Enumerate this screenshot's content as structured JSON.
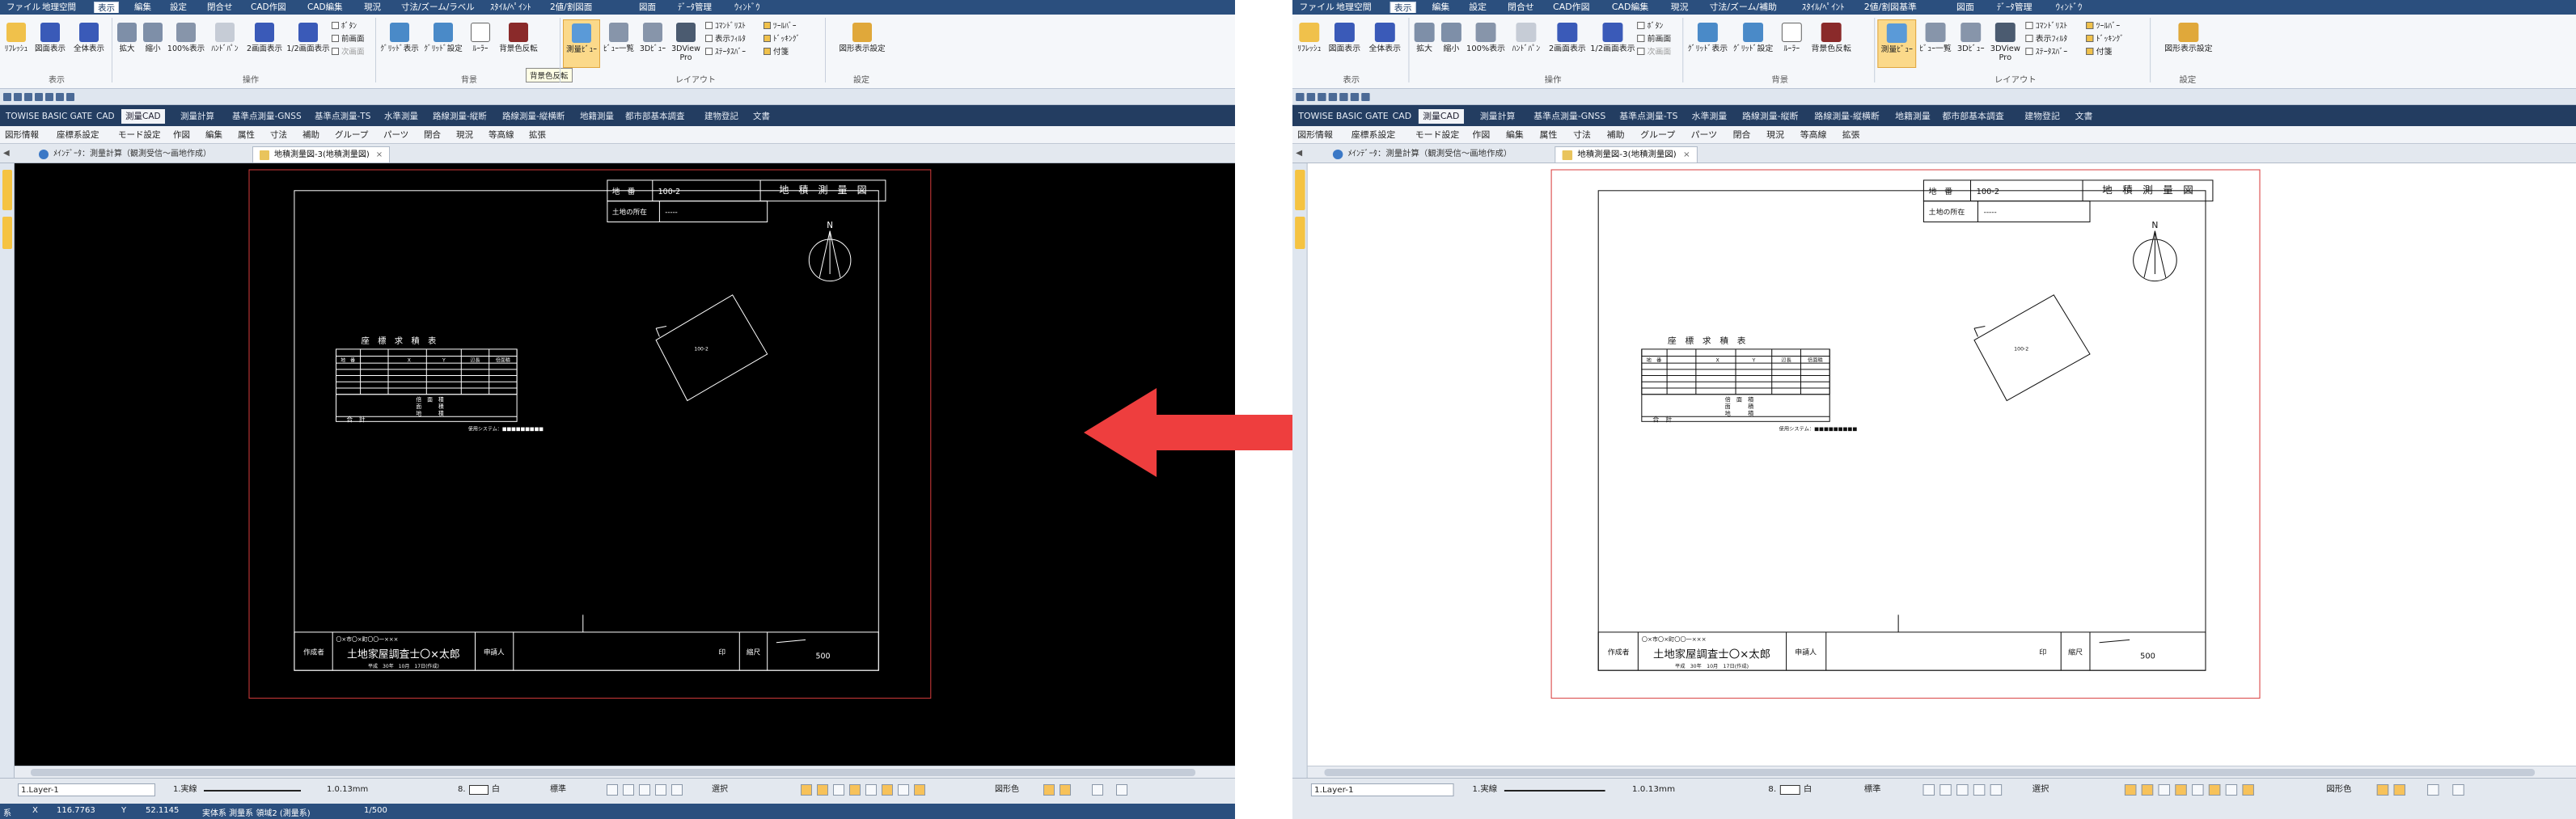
{
  "menubar": [
    "ファイル",
    "地理空間",
    "表示",
    "編集",
    "設定",
    "閉合せ",
    "CAD作図",
    "CAD編集",
    "現況",
    "寸法/ズーム/ラベル",
    "ｽﾀｲﾙ/ﾍﾟｲﾝﾄ",
    "2値/割図面",
    "図面",
    "ﾃﾞｰﾀ管理",
    "ｳｨﾝﾄﾞｳ"
  ],
  "menubar_right": [
    "ファイル",
    "地理空間",
    "表示",
    "編集",
    "設定",
    "閉合せ",
    "CAD作図",
    "CAD編集",
    "現況",
    "寸法/ズーム/補助",
    "ｽﾀｲﾙ/ﾍﾟｲﾝﾄ",
    "2値/割図基準",
    "図面",
    "ﾃﾞｰﾀ管理",
    "ｳｨﾝﾄﾞｳ"
  ],
  "ribbon": {
    "display_group": "表示",
    "operation_group": "操作",
    "background_group": "背景",
    "layout_group": "レイアウト",
    "settings_group": "設定",
    "buttons": [
      "ﾘﾌﾚｯｼｭ",
      "図面表示",
      "全体表示",
      "拡大",
      "縮小",
      "100%表示",
      "ﾊﾝﾄﾞﾊﾟﾝ",
      "2画面表示",
      "1/2画面表示",
      "ｸﾞﾘｯﾄﾞ表示",
      "ｸﾞﾘｯﾄﾞ設定",
      "ﾙｰﾗｰ",
      "背景色反転",
      "測量ﾋﾞｭｰ",
      "ﾋﾞｭｰ一覧",
      "3Dﾋﾞｭｰ",
      "3DView Pro",
      "図形表示設定"
    ],
    "small_buttons": [
      "ﾎﾞﾀﾝ",
      "前画面",
      "次画面",
      "ｺﾏﾝﾄﾞﾘｽﾄ",
      "表示ﾌｨﾙﾀ",
      "ｽﾃｰﾀｽﾊﾞｰ",
      "ﾂｰﾙﾊﾞｰ",
      "ﾄﾞｯｷﾝｸﾞ",
      "付箋"
    ],
    "tooltip": "背景色反転"
  },
  "tabs1": [
    "TOWISE BASIC GATE",
    "CAD",
    "測量CAD",
    "測量計算",
    "基準点測量-GNSS",
    "基準点測量-TS",
    "水準測量",
    "路線測量-縦断",
    "路線測量-縦横断",
    "地籍測量",
    "都市部基本調査",
    "建物登記",
    "文書"
  ],
  "tabs2": [
    "図形情報",
    "座標系設定",
    "モード設定",
    "作図",
    "編集",
    "属性",
    "寸法",
    "補助",
    "グループ",
    "パーツ",
    "閉合",
    "現況",
    "等高線",
    "拡張"
  ],
  "doctabs": [
    {
      "label": "ﾒｲﾝﾃﾞｰﾀ：測量計算（観測受信～画地作成）"
    },
    {
      "label": "地積測量図-3(地積測量図)"
    }
  ],
  "drawing": {
    "parcel_field_label": "地　番",
    "parcel_value": "100-2",
    "title": "地　積　測　量　図",
    "location_label": "土地の所在",
    "location_value": "-----",
    "table_title": "座　標　求　積　表",
    "table_headers": [
      "地　番",
      "X",
      "Y",
      "辺長",
      "倍面積"
    ],
    "area_labels": [
      "倍　面　積",
      "面　　　積",
      "地　　　積"
    ],
    "total_label": "合　計",
    "system_note": "使用システム：■■■■■■■■■",
    "author_address": "〇×市〇×町〇〇一×××",
    "author_name": "土地家屋調査士〇×太郎",
    "date_line": "平成　30年　10月　17日(作成)",
    "author_label": "作成者",
    "applicant_label": "申請人",
    "seal_mark": "印",
    "scale_label": "縮尺",
    "scale_value": "500",
    "north_label": "N"
  },
  "layerbar": {
    "layer": "1.Layer-1",
    "linetype": "1.実線",
    "lineweight": "1.0.13mm",
    "color_num": "8.",
    "color_name": "白",
    "style": "標準",
    "select": "選択",
    "shape_color": "図形色"
  },
  "status": {
    "scale": "1/500",
    "x_label": "X",
    "x_value": "116.7763",
    "y_label": "Y",
    "y_value": "52.1145",
    "coord_system": "系",
    "info": "実体系 測量系 領域2 (測量系)"
  },
  "colors": {
    "menubar": "#2b4f7e",
    "tabbar": "#233d61",
    "canvas_dark": "#000000",
    "canvas_light": "#ffffff",
    "page_border": "#d83c3c",
    "arrow": "#ee3e3e",
    "highlight": "#fbd98a"
  }
}
